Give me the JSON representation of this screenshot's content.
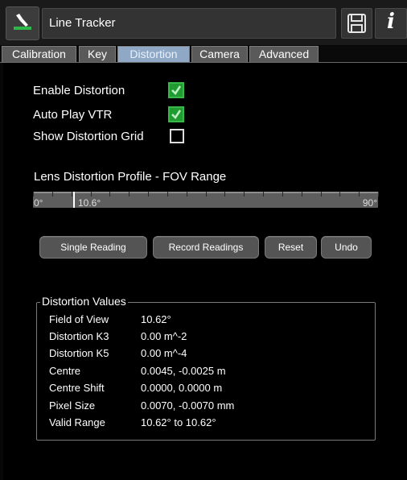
{
  "header": {
    "title": "Line Tracker",
    "app_icon": "tracker-icon",
    "save_icon": "floppy-disk-icon",
    "info_icon": "info-icon",
    "info_glyph": "i"
  },
  "tabs": [
    {
      "label": "Calibration",
      "active": false
    },
    {
      "label": "Key",
      "active": false
    },
    {
      "label": "Distortion",
      "active": true
    },
    {
      "label": "Camera",
      "active": false
    },
    {
      "label": "Advanced",
      "active": false
    }
  ],
  "options": [
    {
      "label": "Enable Distortion",
      "checked": true
    },
    {
      "label": "Auto Play VTR",
      "checked": true
    },
    {
      "label": "Show Distortion Grid",
      "checked": false
    }
  ],
  "fov": {
    "title": "Lens Distortion Profile - FOV Range",
    "min_label": "0°",
    "max_label": "90°",
    "value_label": "10.6°",
    "min": 0,
    "max": 90,
    "value": 10.6
  },
  "buttons": {
    "single_reading": "Single Reading",
    "record_readings": "Record Readings",
    "reset": "Reset",
    "undo": "Undo"
  },
  "values": {
    "title": "Distortion Values",
    "rows": [
      {
        "label": "Field of View",
        "value": "10.62°"
      },
      {
        "label": "Distortion K3",
        "value": "0.00 m^-2"
      },
      {
        "label": "Distortion K5",
        "value": "0.00 m^-4"
      },
      {
        "label": "Centre",
        "value": "0.0045, -0.0025 m"
      },
      {
        "label": "Centre Shift",
        "value": "0.0000, 0.0000 m"
      },
      {
        "label": "Pixel Size",
        "value": "0.0070, -0.0070 mm"
      },
      {
        "label": "Valid Range",
        "value": "10.62° to 10.62°"
      }
    ]
  },
  "colors": {
    "active_tab": "#8fa8c5",
    "checkbox_on": "#1f9b32",
    "accent_green": "#2fb84a"
  }
}
